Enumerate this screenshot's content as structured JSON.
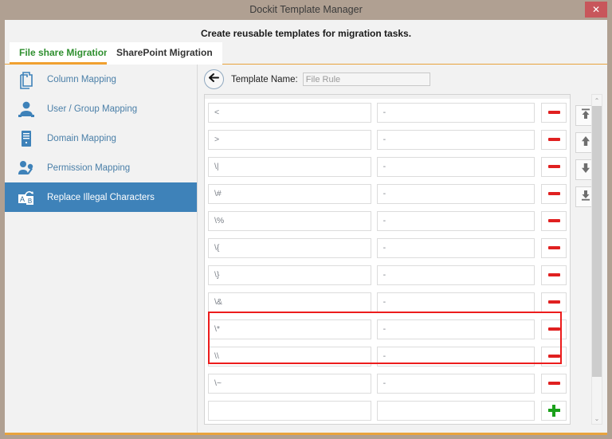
{
  "window": {
    "title": "Dockit Template Manager",
    "close_label": "✕",
    "subtitle": "Create reusable templates for migration tasks.",
    "accent_color": "#e8a33d",
    "frame_color": "#b0a092",
    "close_color": "#c8565b"
  },
  "tabs": [
    {
      "label": "File share Migration",
      "active": true,
      "color": "#2f8f2f"
    },
    {
      "label": "SharePoint Migration",
      "active": false,
      "color": "#333333"
    }
  ],
  "sidebar": {
    "items": [
      {
        "label": "Column Mapping",
        "icon": "documents-icon",
        "selected": false
      },
      {
        "label": "User / Group Mapping",
        "icon": "user-group-icon",
        "selected": false
      },
      {
        "label": "Domain Mapping",
        "icon": "server-icon",
        "selected": false
      },
      {
        "label": "Permission Mapping",
        "icon": "permission-key-icon",
        "selected": false
      },
      {
        "label": "Replace Illegal Characters",
        "icon": "ab-replace-icon",
        "selected": true
      }
    ],
    "selected_color": "#3e82b9",
    "link_color": "#4a7fa8"
  },
  "main": {
    "back_icon": "back-arrow-icon",
    "template_name_label": "Template Name:",
    "template_name_value": "File Rule",
    "template_name_placeholder": "File Rule"
  },
  "grid": {
    "rows": [
      {
        "pattern": "<",
        "replacement": "-",
        "highlighted": false
      },
      {
        "pattern": ">",
        "replacement": "-",
        "highlighted": false
      },
      {
        "pattern": "\\|",
        "replacement": "-",
        "highlighted": false
      },
      {
        "pattern": "\\#",
        "replacement": "-",
        "highlighted": false
      },
      {
        "pattern": "\\%",
        "replacement": "-",
        "highlighted": false
      },
      {
        "pattern": "\\{",
        "replacement": "-",
        "highlighted": false
      },
      {
        "pattern": "\\}",
        "replacement": "-",
        "highlighted": false
      },
      {
        "pattern": "\\&",
        "replacement": "-",
        "highlighted": false
      },
      {
        "pattern": "\\*",
        "replacement": "-",
        "highlighted": true
      },
      {
        "pattern": "\\\\",
        "replacement": "-",
        "highlighted": true
      },
      {
        "pattern": "\\~",
        "replacement": "-",
        "highlighted": false
      }
    ],
    "new_row": {
      "pattern": "",
      "replacement": ""
    },
    "remove_icon": "minus-icon",
    "add_icon": "plus-icon",
    "remove_color": "#e02020",
    "add_color": "#1aa01a",
    "highlight_color": "#ec1c1c"
  },
  "tools": [
    {
      "icon": "move-to-top-icon"
    },
    {
      "icon": "move-up-icon"
    },
    {
      "icon": "move-down-icon"
    },
    {
      "icon": "move-to-bottom-icon"
    }
  ],
  "scrollbar": {
    "up_glyph": "⌃",
    "down_glyph": "⌄"
  }
}
